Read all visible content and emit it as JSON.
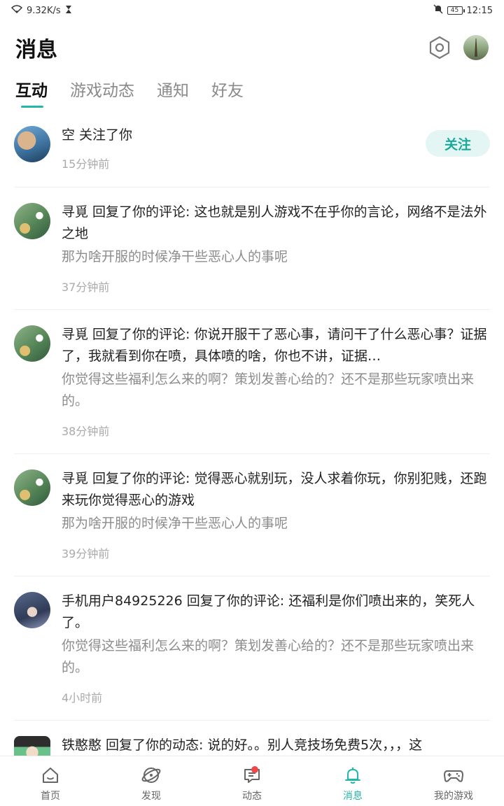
{
  "status_bar": {
    "network_speed": "9.32K/s",
    "battery": "45",
    "time": "12:15"
  },
  "header": {
    "title": "消息"
  },
  "tabs": [
    {
      "label": "互动",
      "active": true
    },
    {
      "label": "游戏动态",
      "active": false
    },
    {
      "label": "通知",
      "active": false
    },
    {
      "label": "好友",
      "active": false
    }
  ],
  "notifications": [
    {
      "message": "空 关注了你",
      "time": "15分钟前",
      "action_label": "关注"
    },
    {
      "message": "寻覓 回复了你的评论: 这也就是别人游戏不在乎你的言论，网络不是法外之地",
      "quote": "那为啥开服的时候净干些恶心人的事呢",
      "time": "37分钟前"
    },
    {
      "message": "寻覓 回复了你的评论: 你说开服干了恶心事，请问干了什么恶心事？证据了，我就看到你在喷，具体喷的啥，你也不讲，证据…",
      "quote": "你觉得这些福利怎么来的啊？策划发善心给的？还不是那些玩家喷出来的。",
      "time": "38分钟前"
    },
    {
      "message": "寻覓 回复了你的评论: 觉得恶心就别玩，没人求着你玩，你别犯贱，还跑来玩你觉得恶心的游戏",
      "quote": "那为啥开服的时候净干些恶心人的事呢",
      "time": "39分钟前"
    },
    {
      "message": "手机用户84925226 回复了你的评论: 还福利是你们喷出来的，笑死人了。",
      "quote": "你觉得这些福利怎么来的啊？策划发善心给的？还不是那些玩家喷出来的。",
      "time": "4小时前"
    },
    {
      "message": "铁憨憨 回复了你的动态: 说的好。。别人竞技场免费5次，，，这"
    }
  ],
  "bottom_nav": [
    {
      "label": "首页",
      "icon": "home-icon",
      "active": false
    },
    {
      "label": "发现",
      "icon": "discover-icon",
      "active": false
    },
    {
      "label": "动态",
      "icon": "feed-icon",
      "active": false,
      "badge": true
    },
    {
      "label": "消息",
      "icon": "bell-icon",
      "active": true
    },
    {
      "label": "我的游戏",
      "icon": "gamepad-icon",
      "active": false
    }
  ],
  "colors": {
    "accent": "#22b7a7",
    "badge": "#f04848"
  }
}
